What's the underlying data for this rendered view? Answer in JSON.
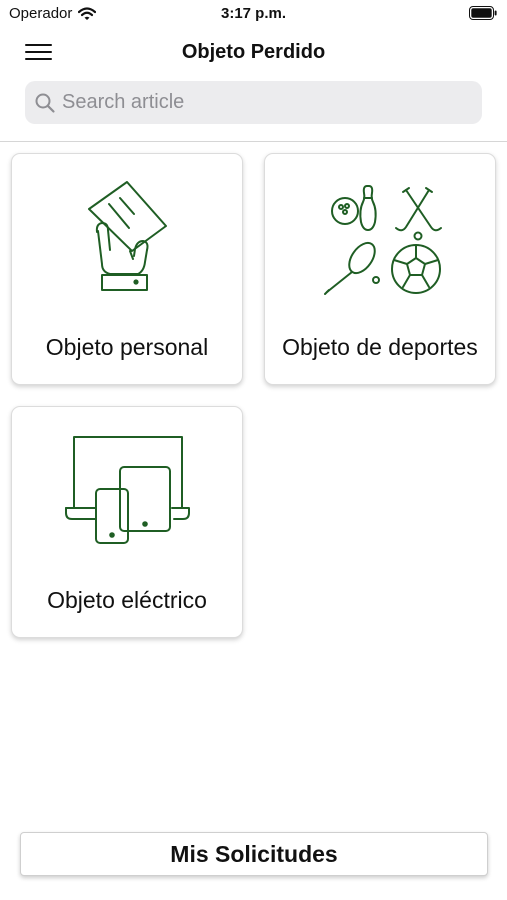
{
  "status_bar": {
    "carrier": "Operador",
    "time": "3:17 p.m."
  },
  "nav": {
    "title": "Objeto Perdido"
  },
  "search": {
    "placeholder": "Search article"
  },
  "categories": [
    {
      "label": "Objeto personal",
      "icon": "hand-holding-card-icon"
    },
    {
      "label": "Objeto de deportes",
      "icon": "sports-equipment-icon"
    },
    {
      "label": "Objeto eléctrico",
      "icon": "electronic-devices-icon"
    }
  ],
  "bottom_button": {
    "label": "Mis Solicitudes"
  },
  "colors": {
    "icon_stroke": "#1f5e24",
    "search_bg": "#ececee",
    "placeholder": "#8e8e93"
  }
}
